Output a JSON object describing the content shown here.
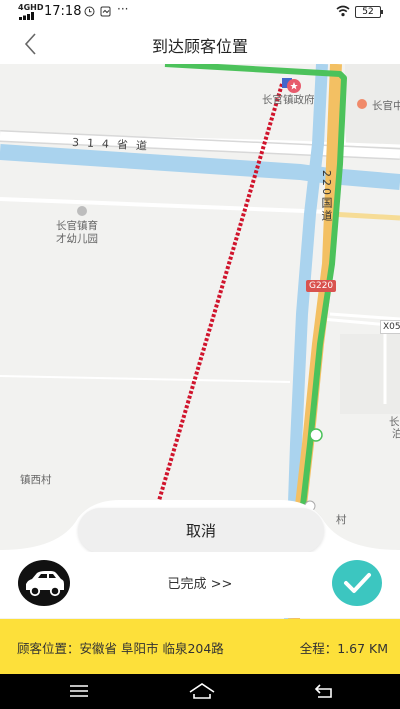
{
  "status_bar": {
    "signal": "4GHD",
    "time": "17:18",
    "battery": "52"
  },
  "header": {
    "title": "到达顾客位置"
  },
  "map": {
    "labels": {
      "government": "长官镇政府",
      "town_right": "长官中",
      "road_314": "314省道",
      "road_220": "220国道",
      "kindergarten_line1": "长官镇育",
      "kindergarten_line2": "才幼儿园",
      "g220": "G220",
      "x05": "X05",
      "village": "镇西村",
      "village_right": "村",
      "right_edge_1": "长",
      "right_edge_2": "泊"
    }
  },
  "actions": {
    "cancel_label": "取消",
    "progress_label": "已完成 >>"
  },
  "info": {
    "address_label": "顾客位置：安徽省 阜阳市 临泉204路",
    "distance_label": "全程：1.67 KM"
  },
  "colors": {
    "accent_yellow": "#fde03a",
    "route_red": "#d0142c",
    "road_green": "#4cc25b",
    "confirm_teal": "#3cc6c0",
    "water_blue": "#aad3ee"
  }
}
